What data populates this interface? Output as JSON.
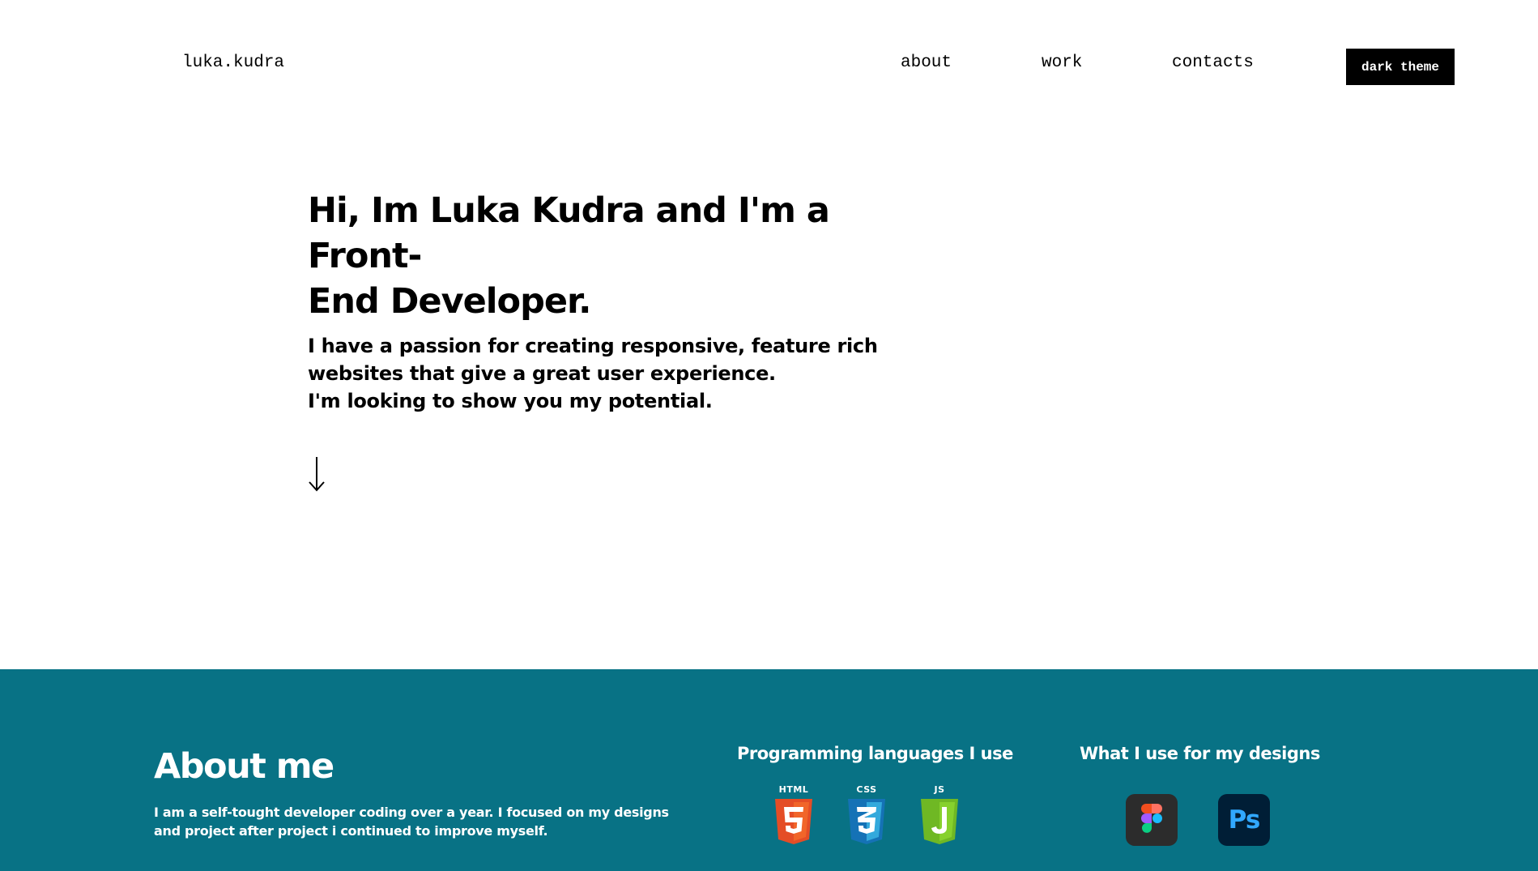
{
  "nav": {
    "logo": "luka.kudra",
    "links": [
      "about",
      "work",
      "contacts"
    ],
    "theme_button": "dark theme"
  },
  "hero": {
    "title_line1": "Hi, Im Luka Kudra and I'm a Front-",
    "title_line2": "End Developer.",
    "text_line1": "I have a passion for creating responsive, feature rich",
    "text_line2": "websites that give a great user experience.",
    "text_line3": "I'm looking to show you my potential.",
    "arrow_icon": "arrow-down-icon"
  },
  "about": {
    "title": "About me",
    "text_line1": "I am a self-tought developer coding over a year. I focused on my designs",
    "text_line2": "and project after project i continued to improve myself.",
    "languages_title": "Programming languages I use",
    "languages": [
      {
        "label": "HTML",
        "icon": "html5-icon",
        "color": "#e44d26"
      },
      {
        "label": "CSS",
        "icon": "css3-icon",
        "color": "#1572b6"
      },
      {
        "label": "JS",
        "icon": "js-icon",
        "color": "#6fb824"
      }
    ],
    "designs_title": "What I use for my designs",
    "tools": [
      {
        "icon": "figma-icon"
      },
      {
        "icon": "photoshop-icon",
        "text": "Ps"
      }
    ]
  },
  "colors": {
    "about_bg": "#087285",
    "button_bg": "#000000",
    "ps_blue": "#31a8ff"
  }
}
